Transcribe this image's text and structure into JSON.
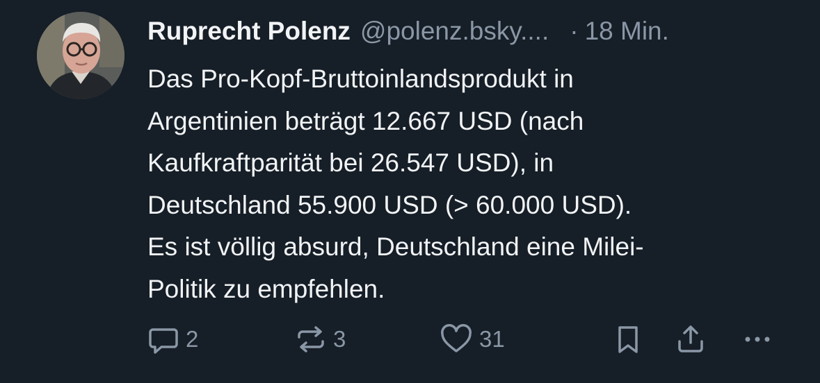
{
  "post": {
    "author": {
      "display_name": "Ruprecht Polenz",
      "handle": "@polenz.bsky....",
      "avatar_icon": "profile-photo"
    },
    "separator": "·",
    "timestamp": "18 Min.",
    "text_lines": [
      "Das Pro-Kopf-Bruttoinlandsprodukt in",
      "Argentinien beträgt 12.667 USD (nach",
      "Kaufkraftparität bei 26.547 USD), in",
      "Deutschland 55.900 USD (> 60.000 USD).",
      "Es ist völlig absurd, Deutschland eine Milei-",
      "Politik zu empfehlen."
    ],
    "actions": {
      "reply": {
        "icon": "speech-bubble-icon",
        "count": "2"
      },
      "repost": {
        "icon": "repost-icon",
        "count": "3"
      },
      "like": {
        "icon": "heart-icon",
        "count": "31"
      },
      "bookmark": {
        "icon": "bookmark-icon"
      },
      "share": {
        "icon": "share-icon"
      },
      "more": {
        "icon": "more-icon"
      }
    }
  },
  "colors": {
    "background": "#161e27",
    "text_primary": "#f1f3f5",
    "text_secondary": "#8a97a6"
  }
}
